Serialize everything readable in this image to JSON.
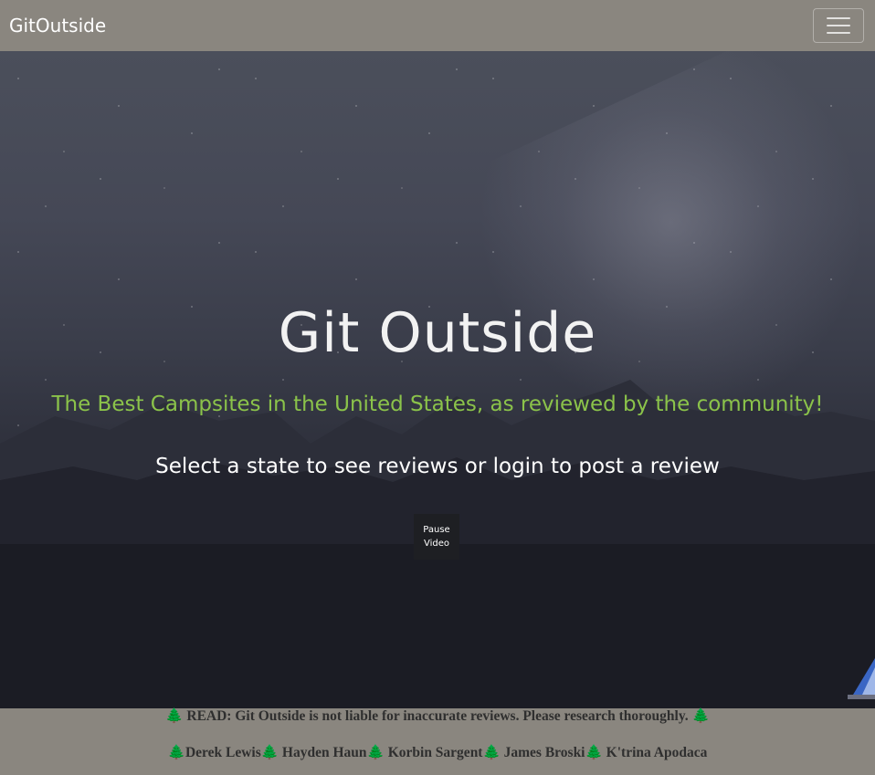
{
  "navbar": {
    "brand": "GitOutside"
  },
  "hero": {
    "title": "Git Outside",
    "subtitle": "The Best Campsites in the United States, as reviewed by the community!",
    "instruction": "Select a state to see reviews or login to post a review",
    "pause_button": "Pause Video"
  },
  "footer": {
    "disclaimer": "🌲 READ: Git Outside is not liable for inaccurate reviews. Please research thoroughly. 🌲",
    "credits": "🌲Derek Lewis🌲 Hayden Haun🌲 Korbin Sargent🌲 James Broski🌲 K'trina Apodaca"
  },
  "colors": {
    "navbar_bg": "#8a867f",
    "subtitle": "#8bc34a",
    "title": "#f2f2f2"
  }
}
